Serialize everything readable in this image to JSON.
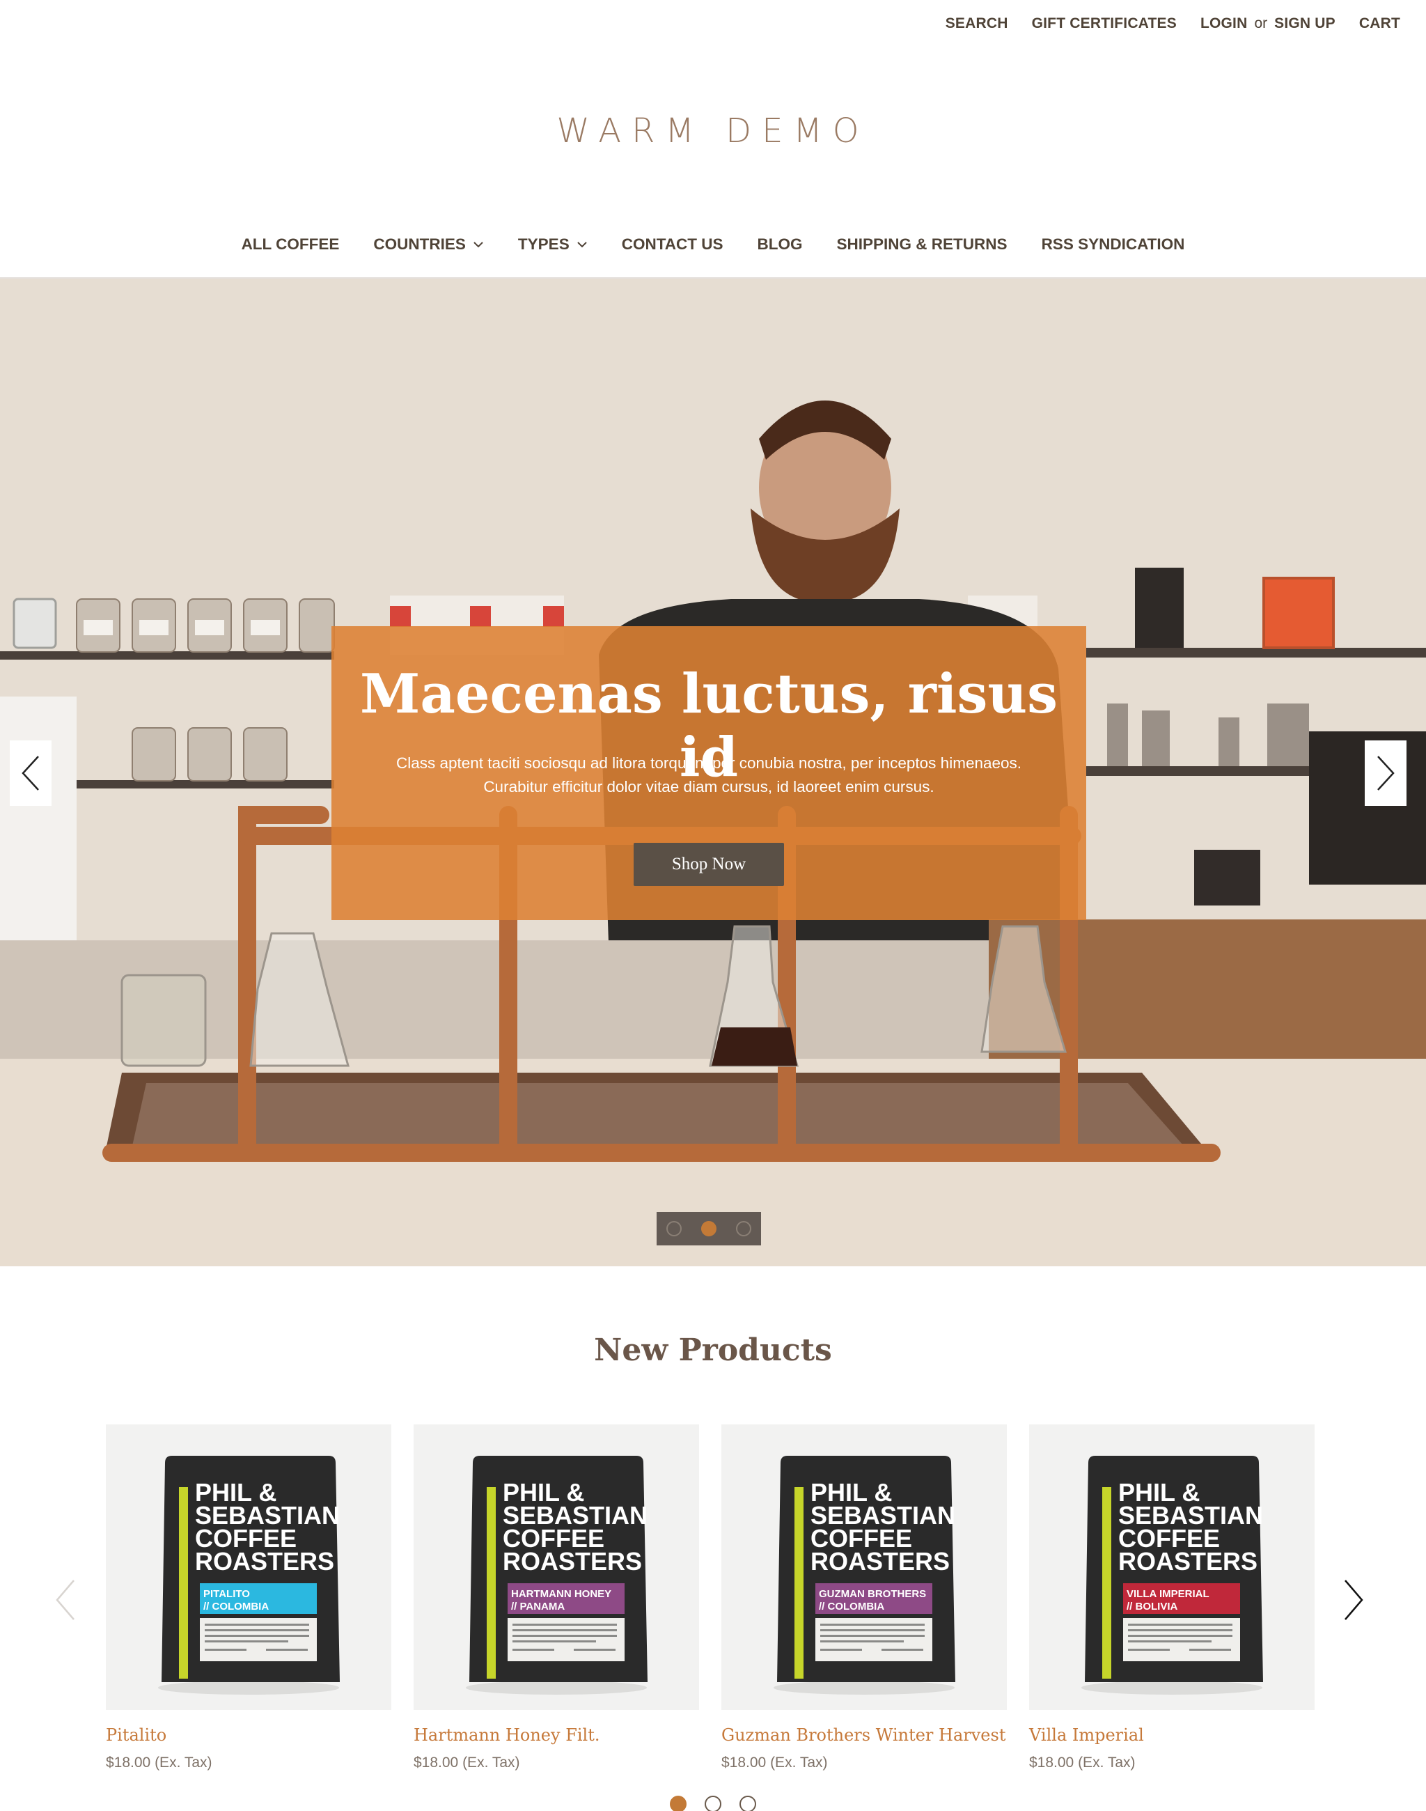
{
  "header": {
    "search": "SEARCH",
    "gift": "GIFT CERTIFICATES",
    "login": "LOGIN",
    "or": "or",
    "signup": "SIGN UP",
    "cart": "CART"
  },
  "logo": "WARM DEMO",
  "nav": {
    "all_coffee": "ALL COFFEE",
    "countries": "COUNTRIES",
    "types": "TYPES",
    "contact": "CONTACT US",
    "blog": "BLOG",
    "shipping": "SHIPPING & RETURNS",
    "rss": "RSS SYNDICATION",
    "dropdown_icon": "chevron-down-icon"
  },
  "hero": {
    "title": "Maecenas luctus, risus id",
    "text": "Class aptent taciti sociosqu ad litora torquent per conubia nostra, per inceptos himenaeos. Curabitur efficitur dolor vitae diam cursus, id laoreet enim cursus.",
    "button": "Shop Now",
    "slide_count": 3,
    "active_slide": 2,
    "overlay_color": "#dd8133"
  },
  "new_products": {
    "title": "New Products",
    "brand_lines": [
      "PHIL &",
      "SEBASTIAN",
      "COFFEE",
      "ROASTERS"
    ],
    "items": [
      {
        "name": "Pitalito",
        "price": "$18.00 (Ex. Tax)",
        "label_top": "PITALITO",
        "label_bottom": "// COLOMBIA",
        "label_color": "#2bb8e0"
      },
      {
        "name": "Hartmann Honey Filt.",
        "price": "$18.00 (Ex. Tax)",
        "label_top": "HARTMANN HONEY",
        "label_bottom": "// PANAMA",
        "label_color": "#8e4a86"
      },
      {
        "name": "Guzman Brothers Winter Harvest",
        "price": "$18.00 (Ex. Tax)",
        "label_top": "GUZMAN BROTHERS",
        "label_bottom": "// COLOMBIA",
        "label_color": "#8e4a86"
      },
      {
        "name": "Villa Imperial",
        "price": "$18.00 (Ex. Tax)",
        "label_top": "VILLA IMPERIAL",
        "label_bottom": "// BOLIVIA",
        "label_color": "#c0283a"
      }
    ],
    "page_count": 3,
    "active_page": 1
  },
  "colors": {
    "accent": "#c37a37",
    "text_dark": "#4f4337",
    "logo": "#9a7a63"
  }
}
